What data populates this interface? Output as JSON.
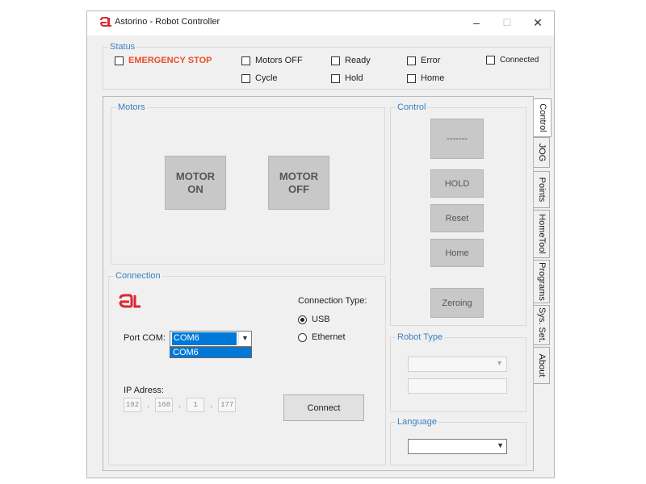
{
  "window": {
    "title": "Astorino - Robot Controller",
    "controls": {
      "minimize": "–",
      "maximize": "☐",
      "close": "✕"
    }
  },
  "status": {
    "title": "Status",
    "items": {
      "emergency_stop": "EMERGENCY STOP",
      "motors_off": "Motors OFF",
      "ready": "Ready",
      "error": "Error",
      "connected": "Connected",
      "cycle": "Cycle",
      "hold": "Hold",
      "home": "Home"
    }
  },
  "motors": {
    "title": "Motors",
    "motor_on": [
      "MOTOR",
      "ON"
    ],
    "motor_off": [
      "MOTOR",
      "OFF"
    ]
  },
  "control": {
    "title": "Control",
    "mode_button": "-------",
    "hold_button": "HOLD",
    "reset_button": "Reset",
    "home_button": "Home",
    "zeroing_button": "Zeroing"
  },
  "connection": {
    "title": "Connection",
    "port_label": "Port COM:",
    "port_value": "COM6",
    "port_options": [
      "COM6"
    ],
    "connection_type_label": "Connection Type:",
    "usb_label": "USB",
    "ethernet_label": "Ethernet",
    "usb_selected": true,
    "ip_label": "IP Adress:",
    "ip": [
      "192",
      "168",
      "1",
      "177"
    ],
    "connect_button": "Connect"
  },
  "robot_type": {
    "title": "Robot Type"
  },
  "language": {
    "title": "Language"
  },
  "tabs": [
    "Control",
    "JOG",
    "Points",
    "HomeTool",
    "Programs",
    "Sys. Set.",
    "About"
  ],
  "colors": {
    "accent": "#3a7fc1",
    "emergency": "#e8502a",
    "logo": "#d9282f",
    "selection": "#0078d7"
  }
}
